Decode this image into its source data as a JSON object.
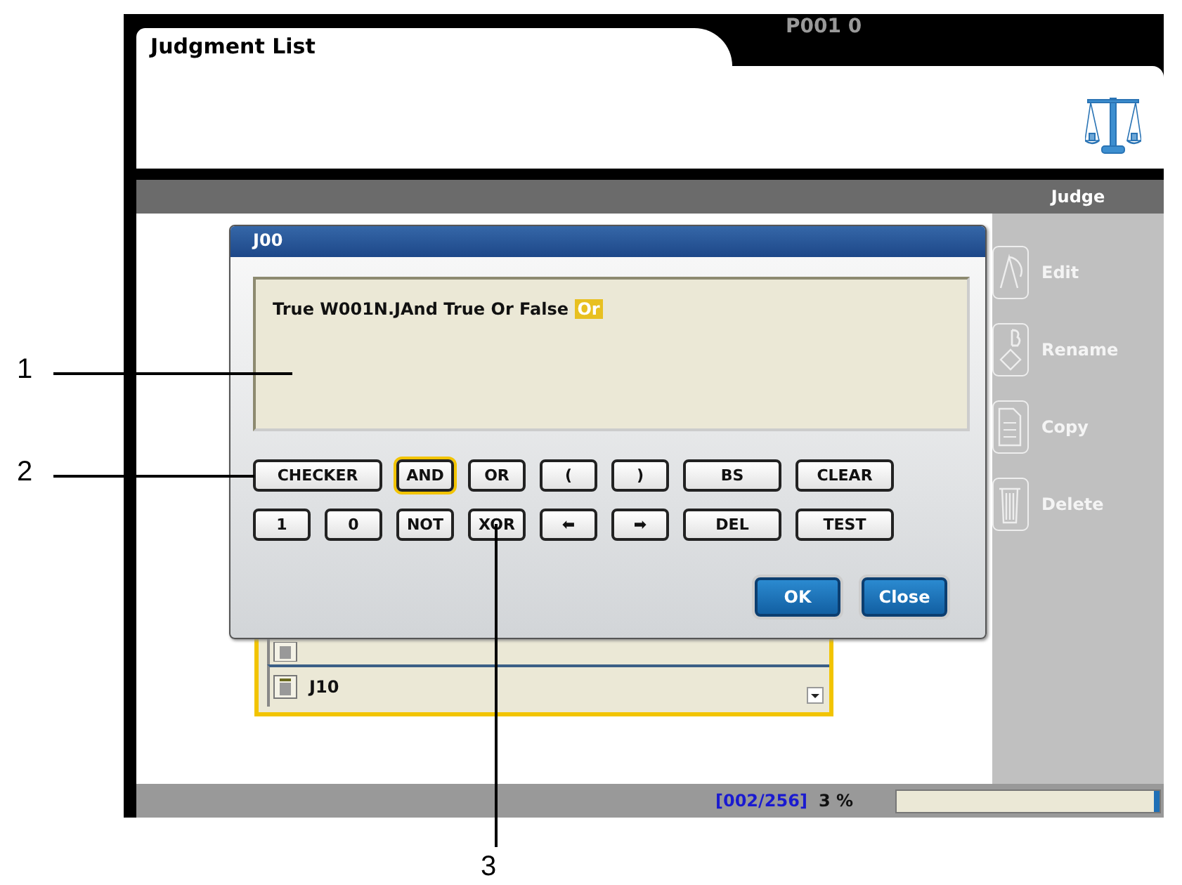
{
  "screen": {
    "title": "Judgment List",
    "program": "P001 0",
    "toolbar": {
      "label": "Judge"
    },
    "sidebar": {
      "items": [
        {
          "label": "Edit",
          "kind": "edit"
        },
        {
          "label": "Rename",
          "kind": "rename"
        },
        {
          "label": "Copy",
          "kind": "copy"
        },
        {
          "label": "Delete",
          "kind": "delete"
        }
      ]
    },
    "list": {
      "items": [
        {
          "label": "J10"
        }
      ]
    },
    "status_bar": {
      "count": "[002/256]",
      "percent": "3 %"
    }
  },
  "dialog": {
    "title": "J00",
    "expression": "True W001N.JAnd True Or False",
    "cursor_token": "Or",
    "keys": [
      {
        "label": "CHECKER",
        "selected": false
      },
      {
        "label": "AND",
        "selected": true
      },
      {
        "label": "OR",
        "selected": false
      },
      {
        "label": "(",
        "selected": false
      },
      {
        "label": ")",
        "selected": false
      },
      {
        "label": "BS",
        "selected": false
      },
      {
        "label": "CLEAR",
        "selected": false
      },
      {
        "label": "1",
        "selected": false
      },
      {
        "label": "0",
        "selected": false
      },
      {
        "label": "NOT",
        "selected": false
      },
      {
        "label": "XOR",
        "selected": false
      },
      {
        "label": "⬅",
        "selected": false
      },
      {
        "label": "➡",
        "selected": false
      },
      {
        "label": "DEL",
        "selected": false
      },
      {
        "label": "TEST",
        "selected": false
      }
    ],
    "actions": [
      "OK",
      "Close"
    ]
  },
  "callouts": [
    {
      "label": "1",
      "kind": "left"
    },
    {
      "label": "2",
      "kind": "left"
    },
    {
      "label": "3",
      "kind": "below"
    }
  ]
}
